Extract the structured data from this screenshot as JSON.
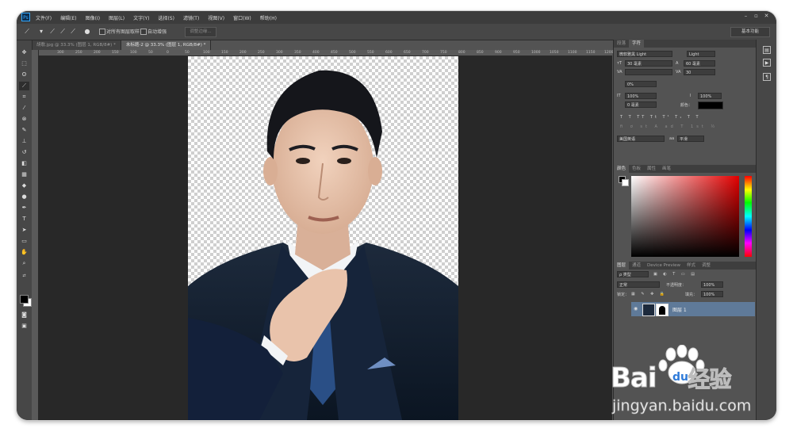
{
  "menu": [
    "文件(F)",
    "编辑(E)",
    "图像(I)",
    "图层(L)",
    "文字(Y)",
    "选择(S)",
    "滤镜(T)",
    "视图(V)",
    "窗口(W)",
    "帮助(H)"
  ],
  "logo": "Ps",
  "options": {
    "check1_label": "对所有图层取样",
    "check2_label": "自动增强",
    "edge_button": "调整边缘...",
    "workspace": "基本功能"
  },
  "tabs": [
    {
      "label": "胡歌.jpg @ 33.3% (图层 1, RGB/8#) *",
      "active": false
    },
    {
      "label": "未标题-2 @ 33.3% (图层 1, RGB/8#) *",
      "active": true
    }
  ],
  "ruler_numbers": [
    "300",
    "250",
    "200",
    "150",
    "100",
    "50",
    "0",
    "50",
    "100",
    "150",
    "200",
    "250",
    "300",
    "350",
    "400",
    "450",
    "500",
    "550",
    "600",
    "650",
    "700",
    "750",
    "800",
    "850",
    "900",
    "950",
    "1000",
    "1050",
    "1100",
    "1150",
    "1200"
  ],
  "char_panel": {
    "tabs": [
      "段落",
      "字符"
    ],
    "font_family": "微软雅黑 Light",
    "font_style": "Light",
    "size": "30 毫素",
    "leading": "60 毫素",
    "kerning": "",
    "tracking": "30",
    "scale_pct": "0%",
    "vscale": "100%",
    "hscale": "100%",
    "baseline": "0 毫素",
    "color_label": "颜色：",
    "lang": "美国英语",
    "aa": "aa",
    "aa_mode": "平滑"
  },
  "color_panel": {
    "tabs": [
      "颜色",
      "色板",
      "属性",
      "画笔"
    ]
  },
  "layers_panel": {
    "tabs": [
      "图层",
      "通道",
      "Device Preview",
      "样式",
      "调整"
    ],
    "kind": "ρ 类型",
    "blend": "正常",
    "opacity_label": "不透明度：",
    "opacity": "100%",
    "lock_label": "锁定：",
    "fill_label": "填充：",
    "fill": "100%",
    "layer_name": "图层 1"
  },
  "watermark": {
    "brand_a": "Bai",
    "brand_b": "du",
    "brand_c": "经验",
    "url": "jingyan.baidu.com"
  },
  "colors": {
    "accent": "#31a8ff",
    "selected_layer": "#5f7a99",
    "paw": "#2f7bd9"
  }
}
